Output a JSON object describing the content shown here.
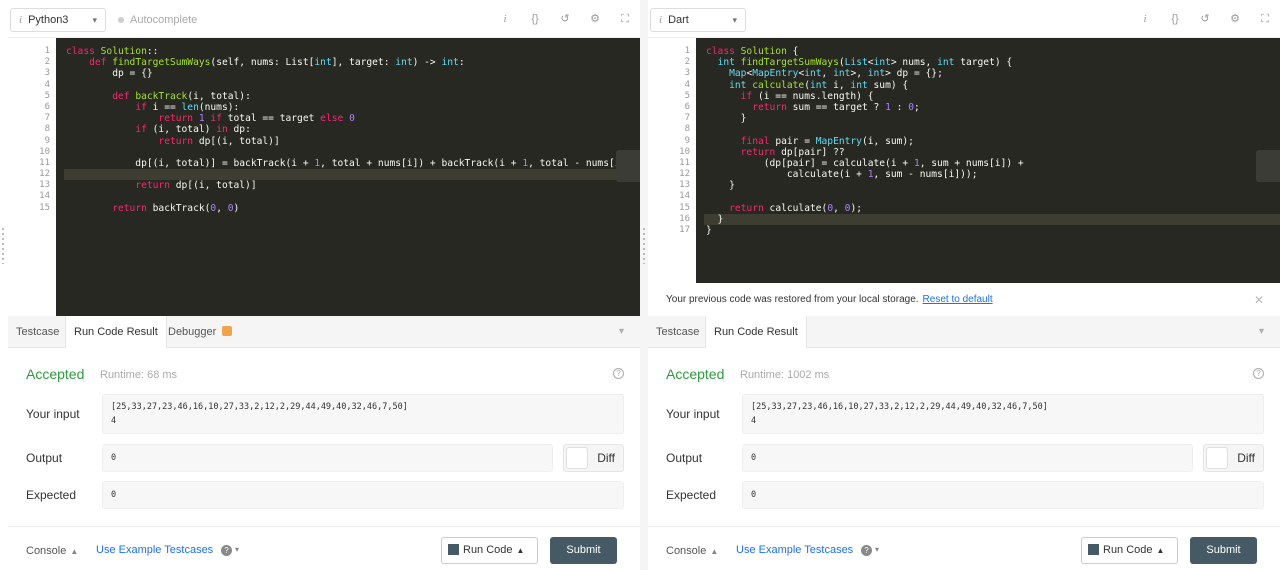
{
  "left": {
    "language": "Python3",
    "autocomplete_label": "Autocomplete",
    "line_numbers": [
      "1",
      "2",
      "3",
      "4",
      "5",
      "6",
      "7",
      "8",
      "9",
      "10",
      "11",
      "12",
      "13",
      "14",
      "15"
    ],
    "tabs": [
      "Testcase",
      "Run Code Result",
      "Debugger"
    ],
    "status": "Accepted",
    "runtime": "Runtime: 68 ms",
    "input_label": "Your input",
    "input_value_line1": "[25,33,27,23,46,16,10,27,33,2,12,2,29,44,49,40,32,46,7,50]",
    "input_value_line2": "4",
    "output_label": "Output",
    "output_value": "0",
    "diff_label": "Diff",
    "expected_label": "Expected",
    "expected_value": "0",
    "console_label": "Console",
    "example_label": "Use Example Testcases",
    "run_label": "Run Code",
    "submit_label": "Submit"
  },
  "right": {
    "language": "Dart",
    "line_numbers": [
      "1",
      "2",
      "3",
      "4",
      "5",
      "6",
      "7",
      "8",
      "9",
      "10",
      "11",
      "12",
      "13",
      "14",
      "15",
      "16",
      "17"
    ],
    "restore_note": "Your previous code was restored from your local storage.",
    "reset_link": "Reset to default",
    "tabs": [
      "Testcase",
      "Run Code Result"
    ],
    "status": "Accepted",
    "runtime": "Runtime: 1002 ms",
    "input_label": "Your input",
    "input_value_line1": "[25,33,27,23,46,16,10,27,33,2,12,2,29,44,49,40,32,46,7,50]",
    "input_value_line2": "4",
    "output_label": "Output",
    "output_value": "0",
    "diff_label": "Diff",
    "expected_label": "Expected",
    "expected_value": "0",
    "console_label": "Console",
    "example_label": "Use Example Testcases",
    "run_label": "Run Code",
    "submit_label": "Submit"
  },
  "python_code": [
    [
      [
        "k",
        "class "
      ],
      [
        "f",
        "Solution"
      ],
      [
        "",
        "::"
      ]
    ],
    [
      [
        "",
        "    "
      ],
      [
        "k",
        "def "
      ],
      [
        "f",
        "findTargetSumWays"
      ],
      [
        "",
        "(self, nums: List["
      ],
      [
        "t",
        "int"
      ],
      [
        "",
        "], target: "
      ],
      [
        "t",
        "int"
      ],
      [
        "",
        ") -> "
      ],
      [
        "t",
        "int"
      ],
      [
        "",
        ":"
      ]
    ],
    [
      [
        "",
        "        dp = {}"
      ]
    ],
    [
      [
        "",
        ""
      ]
    ],
    [
      [
        "",
        "        "
      ],
      [
        "k",
        "def "
      ],
      [
        "f",
        "backTrack"
      ],
      [
        "",
        "(i, total):"
      ]
    ],
    [
      [
        "",
        "            "
      ],
      [
        "k",
        "if "
      ],
      [
        "",
        "i == "
      ],
      [
        "t",
        "len"
      ],
      [
        "",
        "(nums):"
      ]
    ],
    [
      [
        "",
        "                "
      ],
      [
        "k",
        "return "
      ],
      [
        "n",
        "1"
      ],
      [
        "k",
        " if "
      ],
      [
        "",
        "total == target "
      ],
      [
        "k",
        "else "
      ],
      [
        "n",
        "0"
      ]
    ],
    [
      [
        "",
        "            "
      ],
      [
        "k",
        "if "
      ],
      [
        "",
        "(i, total) "
      ],
      [
        "k",
        "in "
      ],
      [
        "",
        "dp:"
      ]
    ],
    [
      [
        "",
        "                "
      ],
      [
        "k",
        "return "
      ],
      [
        "",
        "dp[(i, total)]"
      ]
    ],
    [
      [
        "",
        ""
      ]
    ],
    [
      [
        "",
        "            dp[(i, total)] = backTrack(i + "
      ],
      [
        "n",
        "1"
      ],
      [
        "",
        ", total + nums[i]) + backTrack(i + "
      ],
      [
        "n",
        "1"
      ],
      [
        "",
        ", total - nums[i])"
      ]
    ],
    [
      [
        "",
        ""
      ]
    ],
    [
      [
        "",
        "            "
      ],
      [
        "k",
        "return "
      ],
      [
        "",
        "dp[(i, total)]"
      ]
    ],
    [
      [
        "",
        ""
      ]
    ],
    [
      [
        "",
        "        "
      ],
      [
        "k",
        "return "
      ],
      [
        "",
        "backTrack("
      ],
      [
        "n",
        "0"
      ],
      [
        "",
        ", "
      ],
      [
        "n",
        "0"
      ],
      [
        "",
        ")"
      ]
    ]
  ],
  "dart_code": [
    [
      [
        "k",
        "class "
      ],
      [
        "f",
        "Solution"
      ],
      [
        "",
        " {"
      ]
    ],
    [
      [
        "",
        "  "
      ],
      [
        "t",
        "int "
      ],
      [
        "f",
        "findTargetSumWays"
      ],
      [
        "",
        "("
      ],
      [
        "t",
        "List"
      ],
      [
        "",
        "<"
      ],
      [
        "t",
        "int"
      ],
      [
        "",
        "> nums, "
      ],
      [
        "t",
        "int "
      ],
      [
        "",
        "target) {"
      ]
    ],
    [
      [
        "",
        "    "
      ],
      [
        "t",
        "Map"
      ],
      [
        "",
        "<"
      ],
      [
        "t",
        "MapEntry"
      ],
      [
        "",
        "<"
      ],
      [
        "t",
        "int"
      ],
      [
        "",
        ", "
      ],
      [
        "t",
        "int"
      ],
      [
        "",
        ">, "
      ],
      [
        "t",
        "int"
      ],
      [
        "",
        "> dp = {};"
      ]
    ],
    [
      [
        "",
        "    "
      ],
      [
        "t",
        "int "
      ],
      [
        "f",
        "calculate"
      ],
      [
        "",
        "("
      ],
      [
        "t",
        "int "
      ],
      [
        "",
        "i, "
      ],
      [
        "t",
        "int "
      ],
      [
        "",
        "sum) {"
      ]
    ],
    [
      [
        "",
        "      "
      ],
      [
        "k",
        "if "
      ],
      [
        "",
        "(i == nums.length) {"
      ]
    ],
    [
      [
        "",
        "        "
      ],
      [
        "k",
        "return "
      ],
      [
        "",
        "sum == target ? "
      ],
      [
        "n",
        "1"
      ],
      [
        "",
        " : "
      ],
      [
        "n",
        "0"
      ],
      [
        "",
        ";"
      ]
    ],
    [
      [
        "",
        "      }"
      ]
    ],
    [
      [
        "",
        ""
      ]
    ],
    [
      [
        "",
        "      "
      ],
      [
        "k",
        "final "
      ],
      [
        "",
        "pair = "
      ],
      [
        "t",
        "MapEntry"
      ],
      [
        "",
        "(i, sum);"
      ]
    ],
    [
      [
        "",
        "      "
      ],
      [
        "k",
        "return "
      ],
      [
        "",
        "dp[pair] ??"
      ]
    ],
    [
      [
        "",
        "          (dp[pair] = calculate(i + "
      ],
      [
        "n",
        "1"
      ],
      [
        "",
        ", sum + nums[i]) +"
      ]
    ],
    [
      [
        "",
        "              calculate(i + "
      ],
      [
        "n",
        "1"
      ],
      [
        "",
        ", sum - nums[i]));"
      ]
    ],
    [
      [
        "",
        "    }"
      ]
    ],
    [
      [
        "",
        ""
      ]
    ],
    [
      [
        "",
        "    "
      ],
      [
        "k",
        "return "
      ],
      [
        "",
        "calculate("
      ],
      [
        "n",
        "0"
      ],
      [
        "",
        ", "
      ],
      [
        "n",
        "0"
      ],
      [
        "",
        ");"
      ]
    ],
    [
      [
        "",
        "  }"
      ]
    ],
    [
      [
        "",
        "}"
      ]
    ]
  ]
}
